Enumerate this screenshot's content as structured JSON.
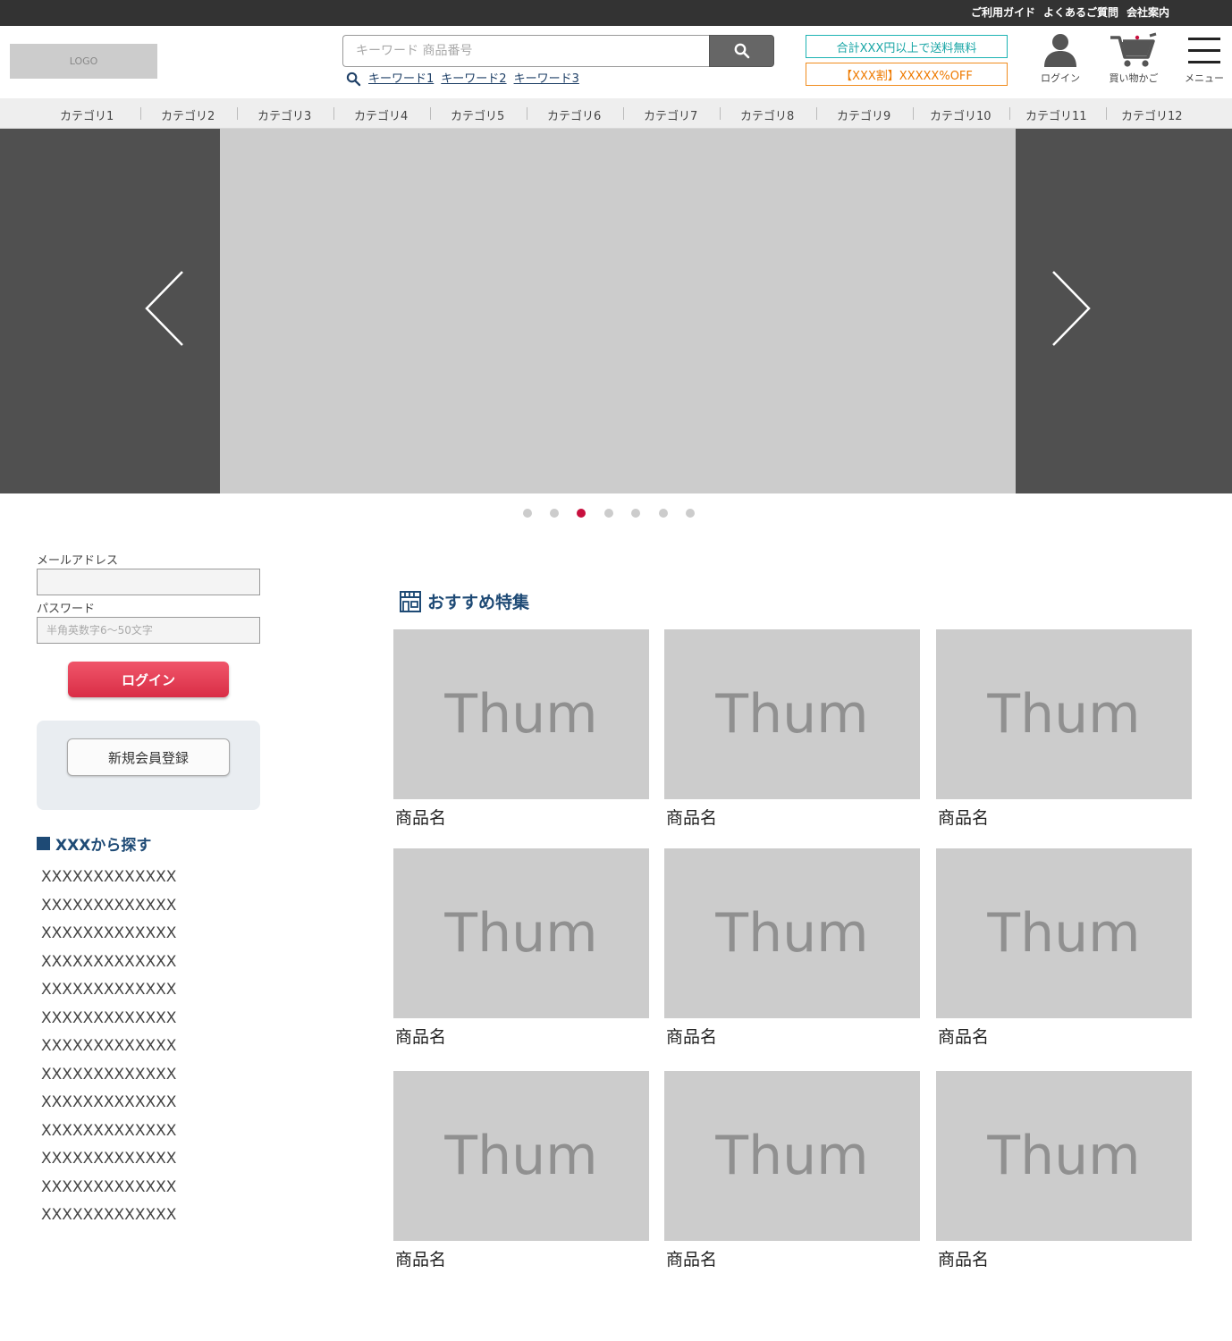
{
  "topbar": {
    "links": [
      "ご利用ガイド",
      "よくあるご質問",
      "会社案内"
    ]
  },
  "header": {
    "logo_text": "LOGO",
    "search": {
      "placeholder": "キーワード 商品番号",
      "button_icon": "search-icon"
    },
    "keywords": [
      "キーワード1",
      "キーワード2",
      "キーワード3"
    ],
    "promo_shipping": "合計XXX円以上で送料無料",
    "promo_discount": "【XXX割】XXXXX%OFF",
    "icons": {
      "login": {
        "icon": "user-icon",
        "label": "ログイン"
      },
      "cart": {
        "icon": "cart-icon",
        "label": "買い物かご"
      },
      "menu": {
        "icon": "hamburger-icon",
        "label": "メニュー"
      }
    }
  },
  "categories": [
    "カテゴリ1",
    "カテゴリ2",
    "カテゴリ3",
    "カテゴリ4",
    "カテゴリ5",
    "カテゴリ6",
    "カテゴリ7",
    "カテゴリ8",
    "カテゴリ9",
    "カテゴリ10",
    "カテゴリ11",
    "カテゴリ12"
  ],
  "slider": {
    "slide_count": 7,
    "active_index": 2,
    "active_color": "#c8103e"
  },
  "login_form": {
    "email_label": "メールアドレス",
    "email_value": "",
    "password_label": "パスワード",
    "password_placeholder": "半角英数字6〜50文字",
    "login_button": "ログイン",
    "register_button": "新規会員登録"
  },
  "browse": {
    "heading": "XXXから探す",
    "items": [
      "XXXXXXXXXXXXX",
      "XXXXXXXXXXXXX",
      "XXXXXXXXXXXXX",
      "XXXXXXXXXXXXX",
      "XXXXXXXXXXXXX",
      "XXXXXXXXXXXXX",
      "XXXXXXXXXXXXX",
      "XXXXXXXXXXXXX",
      "XXXXXXXXXXXXX",
      "XXXXXXXXXXXXX",
      "XXXXXXXXXXXXX",
      "XXXXXXXXXXXXX",
      "XXXXXXXXXXXXX"
    ]
  },
  "featured": {
    "heading": "おすすめ特集",
    "icon": "store-icon",
    "products": [
      {
        "thumb": "Thum",
        "name": "商品名"
      },
      {
        "thumb": "Thum",
        "name": "商品名"
      },
      {
        "thumb": "Thum",
        "name": "商品名"
      },
      {
        "thumb": "Thum",
        "name": "商品名"
      },
      {
        "thumb": "Thum",
        "name": "商品名"
      },
      {
        "thumb": "Thum",
        "name": "商品名"
      },
      {
        "thumb": "Thum",
        "name": "商品名"
      },
      {
        "thumb": "Thum",
        "name": "商品名"
      },
      {
        "thumb": "Thum",
        "name": "商品名"
      }
    ]
  },
  "colors": {
    "topbar": "#333333",
    "accent_blue": "#1e4a75",
    "promo_teal": "#1aa6a6",
    "promo_orange": "#ee7a00",
    "login_red": "#e03a52"
  }
}
